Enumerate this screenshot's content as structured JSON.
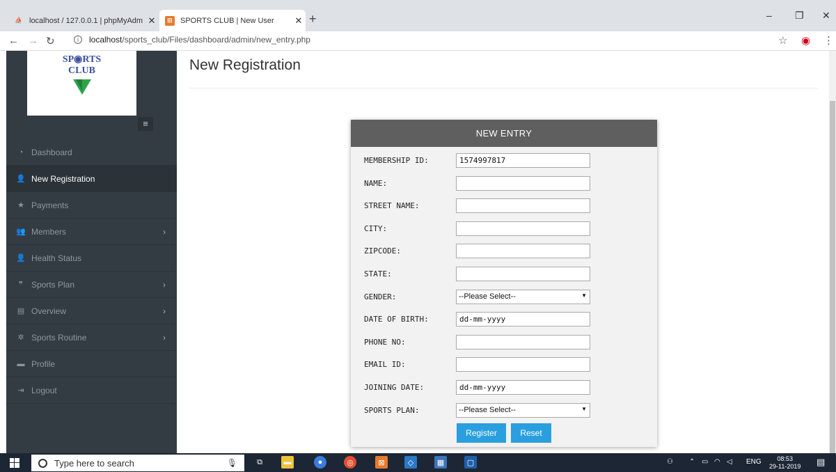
{
  "browser": {
    "tabs": [
      {
        "title": "localhost / 127.0.0.1 | phpMyAdm",
        "close": "✕"
      },
      {
        "title": "SPORTS CLUB | New User",
        "close": "✕"
      }
    ],
    "new_tab": "+",
    "window_controls": {
      "minimize": "–",
      "maximize": "❐",
      "close": "✕"
    },
    "address": {
      "host": "localhost",
      "path": "/sports_club/Files/dashboard/admin/new_entry.php"
    }
  },
  "sidebar": {
    "logo": {
      "line1": "SP◉RTS",
      "line2": "CLUB"
    },
    "toggle_icon": "≡",
    "items": [
      {
        "label": "Dashboard",
        "icon": "dashboard-icon",
        "glyph": "◔",
        "active": false,
        "has_submenu": false
      },
      {
        "label": "New Registration",
        "icon": "user-plus-icon",
        "glyph": "👤",
        "active": true,
        "has_submenu": false
      },
      {
        "label": "Payments",
        "icon": "star-icon",
        "glyph": "★",
        "active": false,
        "has_submenu": false
      },
      {
        "label": "Members",
        "icon": "users-icon",
        "glyph": "👥",
        "active": false,
        "has_submenu": true
      },
      {
        "label": "Health Status",
        "icon": "user-plus-icon",
        "glyph": "👤",
        "active": false,
        "has_submenu": false
      },
      {
        "label": "Sports Plan",
        "icon": "quote-icon",
        "glyph": "❞",
        "active": false,
        "has_submenu": true
      },
      {
        "label": "Overview",
        "icon": "archive-icon",
        "glyph": "▤",
        "active": false,
        "has_submenu": true
      },
      {
        "label": "Sports Routine",
        "icon": "gear-icon",
        "glyph": "✲",
        "active": false,
        "has_submenu": true
      },
      {
        "label": "Profile",
        "icon": "folder-icon",
        "glyph": "▬",
        "active": false,
        "has_submenu": false
      },
      {
        "label": "Logout",
        "icon": "logout-icon",
        "glyph": "⇥",
        "active": false,
        "has_submenu": false
      }
    ],
    "chevron": "›"
  },
  "main": {
    "title": "New Registration"
  },
  "form": {
    "header": "NEW ENTRY",
    "fields": [
      {
        "label": "MEMBERSHIP ID:",
        "value": "1574997817",
        "type": "text",
        "name": "membership-id-field"
      },
      {
        "label": "NAME:",
        "value": "",
        "type": "text",
        "name": "name-field"
      },
      {
        "label": "STREET NAME:",
        "value": "",
        "type": "text",
        "name": "street-name-field"
      },
      {
        "label": "CITY:",
        "value": "",
        "type": "text",
        "name": "city-field"
      },
      {
        "label": "ZIPCODE:",
        "value": "",
        "type": "text",
        "name": "zipcode-field"
      },
      {
        "label": "STATE:",
        "value": "",
        "type": "text",
        "name": "state-field"
      },
      {
        "label": "GENDER:",
        "value": "--Please Select--",
        "type": "select",
        "name": "gender-select"
      },
      {
        "label": "DATE OF BIRTH:",
        "value": "dd-mm-yyyy",
        "type": "text",
        "name": "date-of-birth-field"
      },
      {
        "label": "PHONE NO:",
        "value": "",
        "type": "text",
        "name": "phone-field"
      },
      {
        "label": "EMAIL ID:",
        "value": "",
        "type": "text",
        "name": "email-field"
      },
      {
        "label": "JOINING DATE:",
        "value": "dd-mm-yyyy",
        "type": "text",
        "name": "joining-date-field"
      },
      {
        "label": "SPORTS PLAN:",
        "value": "--Please Select--",
        "type": "select",
        "name": "sports-plan-select"
      }
    ],
    "select_arrow": "▼",
    "register_label": "Register",
    "reset_label": "Reset"
  },
  "taskbar": {
    "search_placeholder": "Type here to search",
    "tray": {
      "lang": "ENG",
      "time": "08:53",
      "date": "29-11-2019"
    }
  },
  "colors": {
    "sidebar": "#343c43",
    "card_header": "#5f5f5f",
    "button": "#2a9fe0",
    "taskbar": "#1c2635"
  }
}
